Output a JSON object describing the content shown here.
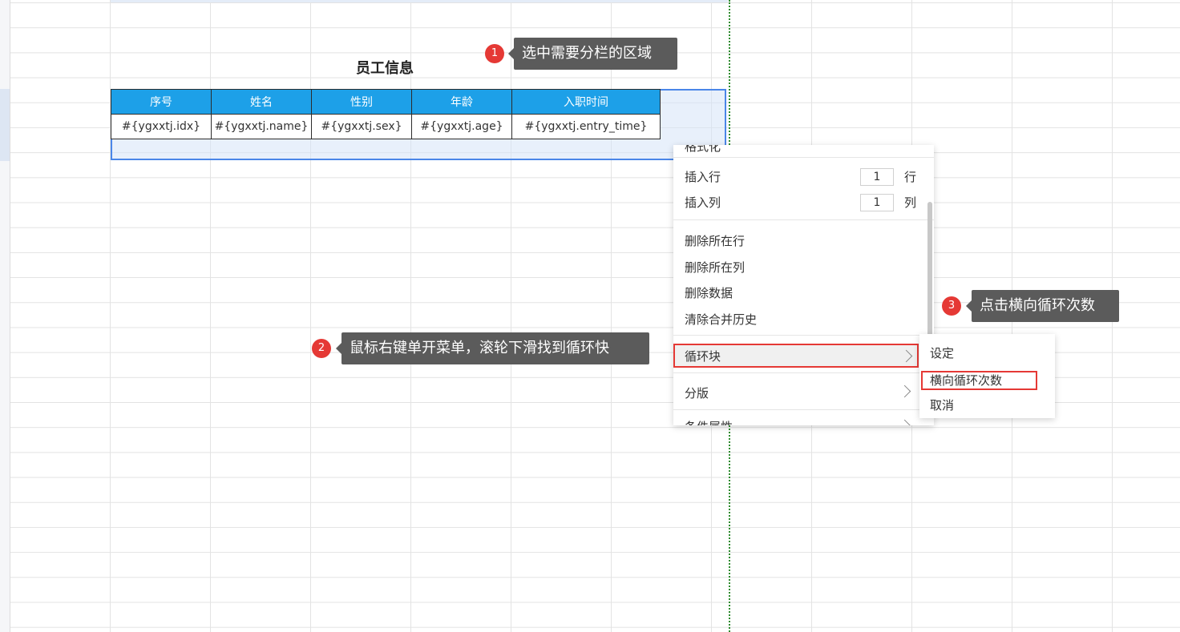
{
  "report": {
    "title": "员工信息",
    "headers": [
      "序号",
      "姓名",
      "性别",
      "年龄",
      "入职时间"
    ],
    "row": [
      "#{ygxxtj.idx}",
      "#{ygxxtj.name}",
      "#{ygxxtj.sex}",
      "#{ygxxtj.age}",
      "#{ygxxtj.entry_time}"
    ]
  },
  "context_menu": {
    "cut_label": "格式化",
    "insert_row": {
      "label": "插入行",
      "value": "1",
      "unit": "行"
    },
    "insert_col": {
      "label": "插入列",
      "value": "1",
      "unit": "列"
    },
    "delete_row": "删除所在行",
    "delete_col": "删除所在列",
    "delete_data": "删除数据",
    "clear_merge": "清除合并历史",
    "loop_block": "循环块",
    "page_split": "分版",
    "next_cut": "条件属性"
  },
  "sub_menu": {
    "set": "设定",
    "horizontal_loop": "横向循环次数",
    "cancel": "取消"
  },
  "callouts": [
    {
      "num": "1",
      "text": "选中需要分栏的区域"
    },
    {
      "num": "2",
      "text": "鼠标右键单开菜单，滚轮下滑找到循环快"
    },
    {
      "num": "3",
      "text": "点击横向循环次数"
    }
  ],
  "colors": {
    "header_bg": "#1da0e8",
    "accent_red": "#e53935",
    "callout_bg": "#5b5b5b"
  }
}
